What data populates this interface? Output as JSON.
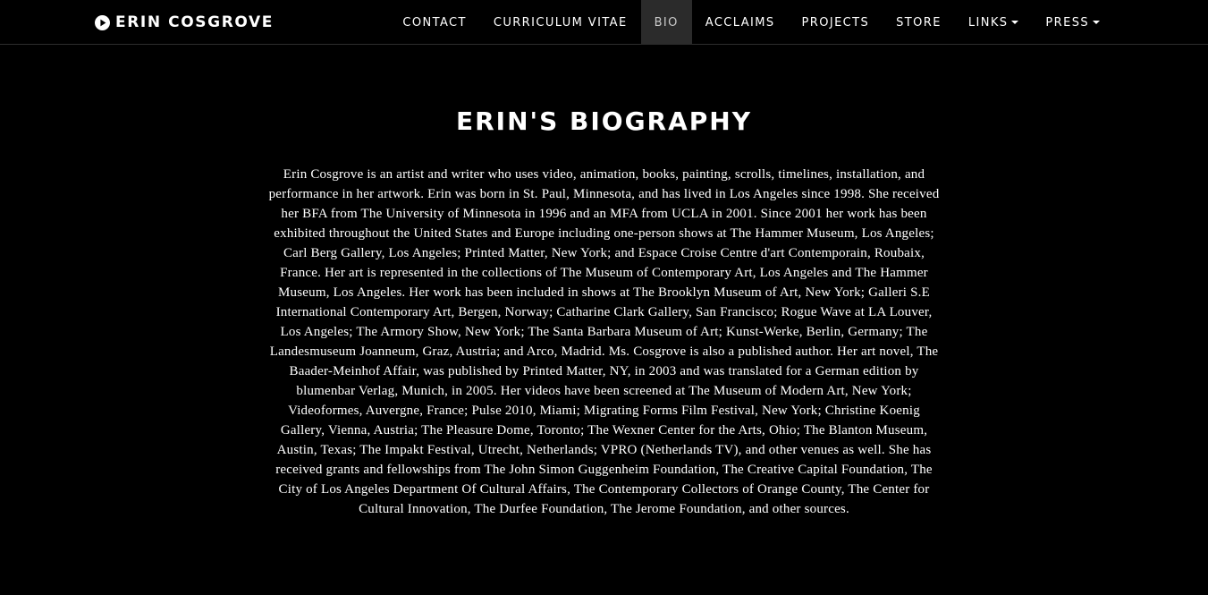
{
  "header": {
    "brand": {
      "icon": "play-circle-icon",
      "name": "ERIN COSGROVE"
    },
    "nav": [
      {
        "label": "CONTACT",
        "active": false,
        "dropdown": false
      },
      {
        "label": "CURRICULUM VITAE",
        "active": false,
        "dropdown": false
      },
      {
        "label": "BIO",
        "active": true,
        "dropdown": false
      },
      {
        "label": "ACCLAIMS",
        "active": false,
        "dropdown": false
      },
      {
        "label": "PROJECTS",
        "active": false,
        "dropdown": false
      },
      {
        "label": "STORE",
        "active": false,
        "dropdown": false
      },
      {
        "label": "LINKS",
        "active": false,
        "dropdown": true
      },
      {
        "label": "PRESS",
        "active": false,
        "dropdown": true
      }
    ]
  },
  "main": {
    "title": "ERIN'S BIOGRAPHY",
    "bio": "Erin Cosgrove is an artist and writer who uses video, animation, books, painting, scrolls, timelines, installation, and performance in her artwork. Erin was born in St. Paul, Minnesota, and has lived in Los Angeles since 1998. She received her BFA from The University of Minnesota in 1996 and an MFA from UCLA in 2001. Since 2001 her work has been exhibited throughout the United States and Europe including one-person shows at The Hammer Museum, Los Angeles; Carl Berg Gallery, Los Angeles; Printed Matter, New York; and Espace Croise Centre d'art Contemporain, Roubaix, France. Her art is represented in the collections of The Museum of Contemporary Art, Los Angeles and The Hammer Museum, Los Angeles. Her work has been included in shows at The Brooklyn Museum of Art, New York; Galleri S.E International Contemporary Art, Bergen, Norway; Catharine Clark Gallery, San Francisco; Rogue Wave at LA Louver, Los Angeles; The Armory Show, New York; The Santa Barbara Museum of Art; Kunst-Werke, Berlin, Germany; The Landesmuseum Joanneum, Graz, Austria; and Arco, Madrid. Ms. Cosgrove is also a published author. Her art novel, The Baader-Meinhof Affair, was published by Printed Matter, NY, in 2003 and was translated for a German edition by blumenbar Verlag, Munich, in 2005. Her videos have been screened at The Museum of Modern Art, New York; Videoformes, Auvergne, France; Pulse 2010, Miami; Migrating Forms Film Festival, New York; Christine Koenig Gallery, Vienna, Austria; The Pleasure Dome, Toronto; The Wexner Center for the Arts, Ohio; The Blanton Museum, Austin, Texas; The Impakt Festival, Utrecht, Netherlands; VPRO (Netherlands TV), and other venues as well. She has received grants and fellowships from The John Simon Guggenheim Foundation, The Creative Capital Foundation, The City of Los Angeles Department Of Cultural Affairs, The Contemporary Collectors of Orange County, The Center for Cultural Innovation, The Durfee Foundation, The Jerome Foundation, and other sources."
  },
  "colors": {
    "background": "#000000",
    "text": "#ffffff",
    "active_nav_bg": "#2b2b2b",
    "divider": "#2e2e2e"
  }
}
